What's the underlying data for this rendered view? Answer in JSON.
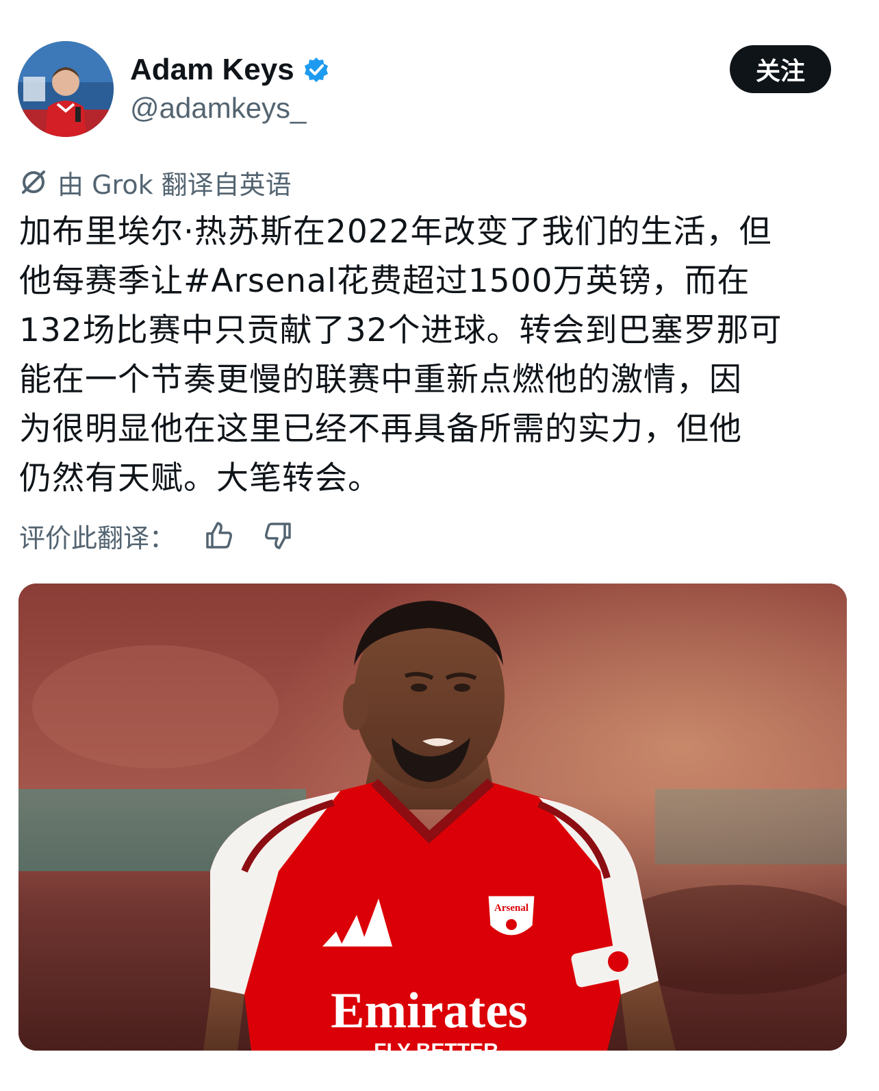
{
  "author": {
    "display_name": "Adam Keys",
    "handle": "@adamkeys_",
    "verified": true,
    "avatar_icon": "user-avatar"
  },
  "follow_button": {
    "label": "关注"
  },
  "translation_notice": {
    "icon": "grok-icon",
    "text": "由 Grok 翻译自英语"
  },
  "tweet": {
    "lines": [
      "加布里埃尔·热苏斯在2022年改变了我们的生活，但",
      "他每赛季让#Arsenal花费超过1500万英镑，而在",
      "132场比赛中只贡献了32个进球。转会到巴塞罗那可",
      "能在一个节奏更慢的联赛中重新点燃他的激情，因",
      "为很明显他在这里已经不再具备所需的实力，但他",
      "仍然有天赋。大笔转会。"
    ]
  },
  "rate_translation": {
    "label": "评价此翻译：",
    "thumbs_up_icon": "thumbs-up-icon",
    "thumbs_down_icon": "thumbs-down-icon"
  },
  "media": {
    "jersey_sponsor": "Emirates",
    "jersey_sponsor_sub": "FLY BETTER",
    "crest_text": "Arsenal"
  },
  "colors": {
    "text_primary": "#0f1419",
    "text_secondary": "#536471",
    "verified_blue": "#1d9bf0",
    "follow_bg": "#0f1419",
    "arsenal_red": "#db0007"
  }
}
